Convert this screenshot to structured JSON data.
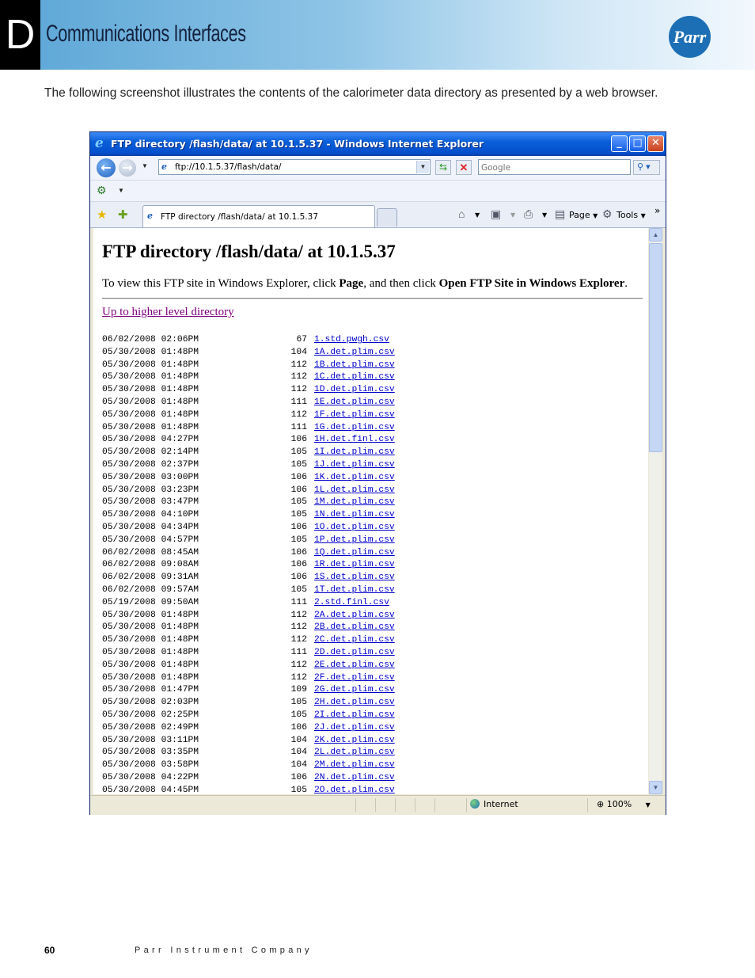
{
  "page": {
    "section_letter": "D",
    "section_title": "Communications Interfaces",
    "logo_text": "Parr",
    "intro": "The following screenshot illustrates the contents of the calorimeter data directory as presented by a web browser.",
    "page_number": "60",
    "company": "Parr Instrument Company"
  },
  "browser": {
    "window_title": "FTP directory /flash/data/ at 10.1.5.37 - Windows Internet Explorer",
    "address": "ftp://10.1.5.37/flash/data/",
    "search_placeholder": "Google",
    "tab_title": "FTP directory /flash/data/ at 10.1.5.37",
    "page_menu": "Page",
    "tools_menu": "Tools",
    "status_zone": "Internet",
    "zoom": "100%"
  },
  "content": {
    "heading": "FTP directory /flash/data/ at 10.1.5.37",
    "instruction_pre": "To view this FTP site in Windows Explorer, click ",
    "instruction_page": "Page",
    "instruction_mid": ", and then click ",
    "instruction_open": "Open FTP Site in Windows Explorer",
    "instruction_end": ".",
    "up_link": "Up to higher level directory"
  },
  "files": [
    {
      "datetime": "06/02/2008 02:06PM",
      "size": "67",
      "name": "1.std.pwgh.csv"
    },
    {
      "datetime": "05/30/2008 01:48PM",
      "size": "104",
      "name": "1A.det.plim.csv"
    },
    {
      "datetime": "05/30/2008 01:48PM",
      "size": "112",
      "name": "1B.det.plim.csv"
    },
    {
      "datetime": "05/30/2008 01:48PM",
      "size": "112",
      "name": "1C.det.plim.csv"
    },
    {
      "datetime": "05/30/2008 01:48PM",
      "size": "112",
      "name": "1D.det.plim.csv"
    },
    {
      "datetime": "05/30/2008 01:48PM",
      "size": "111",
      "name": "1E.det.plim.csv"
    },
    {
      "datetime": "05/30/2008 01:48PM",
      "size": "112",
      "name": "1F.det.plim.csv"
    },
    {
      "datetime": "05/30/2008 01:48PM",
      "size": "111",
      "name": "1G.det.plim.csv"
    },
    {
      "datetime": "05/30/2008 04:27PM",
      "size": "106",
      "name": "1H.det.finl.csv"
    },
    {
      "datetime": "05/30/2008 02:14PM",
      "size": "105",
      "name": "1I.det.plim.csv"
    },
    {
      "datetime": "05/30/2008 02:37PM",
      "size": "105",
      "name": "1J.det.plim.csv"
    },
    {
      "datetime": "05/30/2008 03:00PM",
      "size": "106",
      "name": "1K.det.plim.csv"
    },
    {
      "datetime": "05/30/2008 03:23PM",
      "size": "106",
      "name": "1L.det.plim.csv"
    },
    {
      "datetime": "05/30/2008 03:47PM",
      "size": "105",
      "name": "1M.det.plim.csv"
    },
    {
      "datetime": "05/30/2008 04:10PM",
      "size": "105",
      "name": "1N.det.plim.csv"
    },
    {
      "datetime": "05/30/2008 04:34PM",
      "size": "106",
      "name": "1O.det.plim.csv"
    },
    {
      "datetime": "05/30/2008 04:57PM",
      "size": "105",
      "name": "1P.det.plim.csv"
    },
    {
      "datetime": "06/02/2008 08:45AM",
      "size": "106",
      "name": "1Q.det.plim.csv"
    },
    {
      "datetime": "06/02/2008 09:08AM",
      "size": "106",
      "name": "1R.det.plim.csv"
    },
    {
      "datetime": "06/02/2008 09:31AM",
      "size": "106",
      "name": "1S.det.plim.csv"
    },
    {
      "datetime": "06/02/2008 09:57AM",
      "size": "105",
      "name": "1T.det.plim.csv"
    },
    {
      "datetime": "05/19/2008 09:50AM",
      "size": "111",
      "name": "2.std.finl.csv"
    },
    {
      "datetime": "05/30/2008 01:48PM",
      "size": "112",
      "name": "2A.det.plim.csv"
    },
    {
      "datetime": "05/30/2008 01:48PM",
      "size": "112",
      "name": "2B.det.plim.csv"
    },
    {
      "datetime": "05/30/2008 01:48PM",
      "size": "112",
      "name": "2C.det.plim.csv"
    },
    {
      "datetime": "05/30/2008 01:48PM",
      "size": "111",
      "name": "2D.det.plim.csv"
    },
    {
      "datetime": "05/30/2008 01:48PM",
      "size": "112",
      "name": "2E.det.plim.csv"
    },
    {
      "datetime": "05/30/2008 01:48PM",
      "size": "112",
      "name": "2F.det.plim.csv"
    },
    {
      "datetime": "05/30/2008 01:47PM",
      "size": "109",
      "name": "2G.det.plim.csv"
    },
    {
      "datetime": "05/30/2008 02:03PM",
      "size": "105",
      "name": "2H.det.plim.csv"
    },
    {
      "datetime": "05/30/2008 02:25PM",
      "size": "105",
      "name": "2I.det.plim.csv"
    },
    {
      "datetime": "05/30/2008 02:49PM",
      "size": "106",
      "name": "2J.det.plim.csv"
    },
    {
      "datetime": "05/30/2008 03:11PM",
      "size": "104",
      "name": "2K.det.plim.csv"
    },
    {
      "datetime": "05/30/2008 03:35PM",
      "size": "104",
      "name": "2L.det.plim.csv"
    },
    {
      "datetime": "05/30/2008 03:58PM",
      "size": "104",
      "name": "2M.det.plim.csv"
    },
    {
      "datetime": "05/30/2008 04:22PM",
      "size": "106",
      "name": "2N.det.plim.csv"
    },
    {
      "datetime": "05/30/2008 04:45PM",
      "size": "105",
      "name": "2O.det.plim.csv"
    }
  ]
}
